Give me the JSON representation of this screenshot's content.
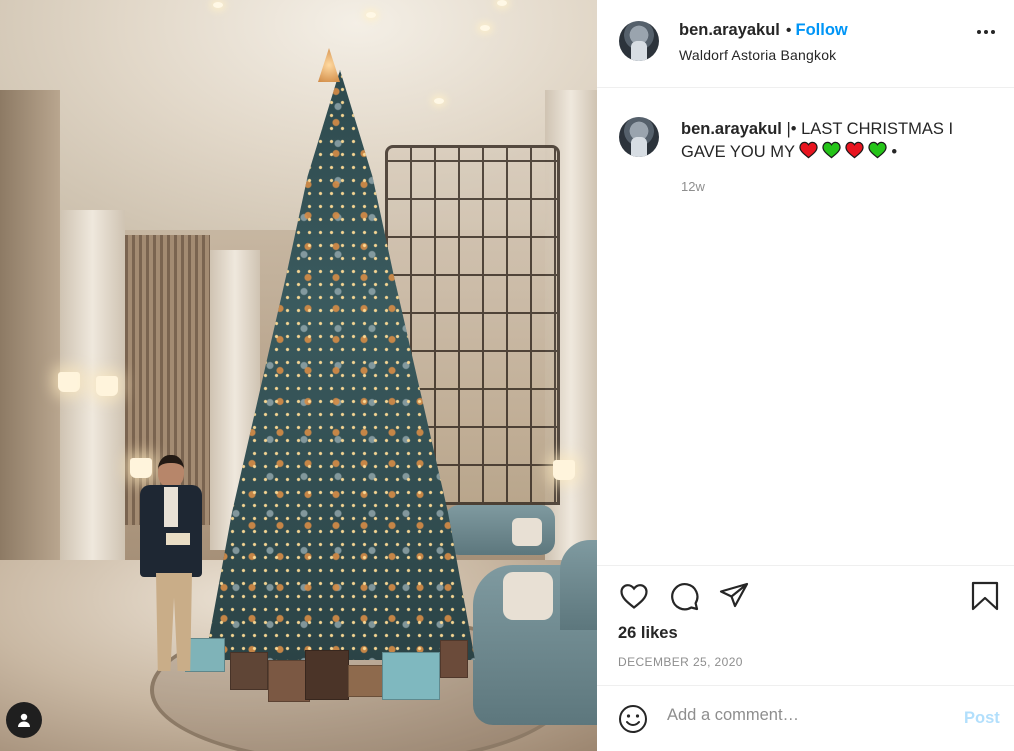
{
  "post": {
    "username": "ben.arayakul",
    "follow_label": "Follow",
    "location": "Waldorf Astoria Bangkok",
    "caption_prefix": "|• LAST CHRISTMAS I GAVE YOU MY",
    "caption_suffix": "•",
    "caption_hearts": [
      "red",
      "green",
      "red",
      "green"
    ],
    "time_ago": "12w",
    "likes": "26 likes",
    "date": "DECEMBER 25, 2020"
  },
  "comment": {
    "placeholder": "Add a comment…",
    "post_label": "Post"
  },
  "colors": {
    "accent": "#0095f6",
    "post_disabled": "#b2dffc",
    "heart_red": "#e8141f",
    "heart_green": "#25c419"
  },
  "icons": [
    "more-options-icon",
    "like-heart-icon",
    "comment-icon",
    "share-icon",
    "save-bookmark-icon",
    "emoji-icon",
    "profile-icon"
  ]
}
